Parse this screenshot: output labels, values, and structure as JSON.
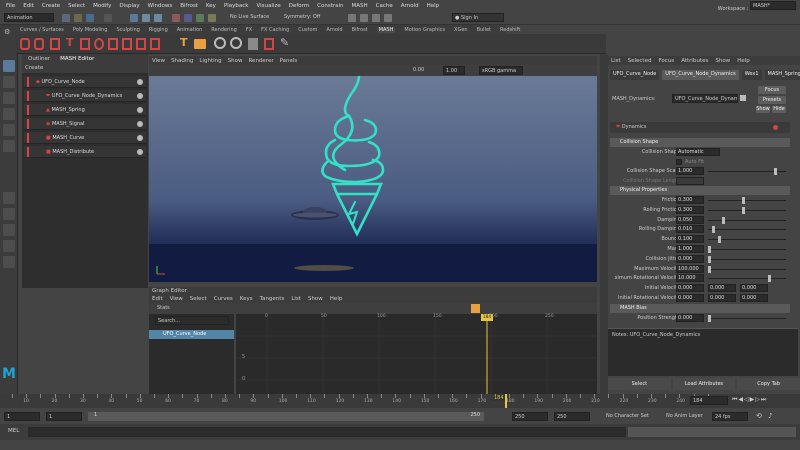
{
  "menu": [
    "File",
    "Edit",
    "Create",
    "Select",
    "Modify",
    "Display",
    "Windows",
    "Bifrost",
    "Key",
    "Playback",
    "Visualize",
    "Deform",
    "Constrain",
    "MASH",
    "Cache",
    "Arnold",
    "Help"
  ],
  "workspace": {
    "label": "Workspace :",
    "value": "MASH*"
  },
  "status": {
    "mode": "Animation",
    "live_surface": "No Live Surface",
    "symmetry": "Symmetry: Off",
    "sign_in": "Sign In"
  },
  "shelf_tabs": [
    "Curves / Surfaces",
    "Poly Modeling",
    "Sculpting",
    "Rigging",
    "Animation",
    "Rendering",
    "FX",
    "FX Caching",
    "Custom",
    "Arnold",
    "Bifrost",
    "MASH",
    "Motion Graphics",
    "XGen",
    "Bullet",
    "Redshift"
  ],
  "shelf_active": "MASH",
  "outliner": {
    "tabs": [
      "Outliner",
      "MASH Editor"
    ],
    "create": "Create",
    "nodes": [
      "UFO_Curve_Node",
      "UFO_Curve_Node_Dynamics",
      "MASH_Spring",
      "MASH_Signal",
      "MASH_Curve",
      "MASH_Distribute"
    ]
  },
  "viewport": {
    "menu": [
      "View",
      "Shading",
      "Lighting",
      "Show",
      "Renderer",
      "Panels"
    ],
    "num1": "0.00",
    "num2": "1.00",
    "colorspace": "sRGB gamma"
  },
  "graph_editor": {
    "title": "Graph Editor",
    "menu": [
      "Edit",
      "View",
      "Select",
      "Curves",
      "Keys",
      "Tangents",
      "List",
      "Show",
      "Help"
    ],
    "stats": "Stats",
    "search": "Search...",
    "node": "UFO_Curve_Node",
    "frame": "184",
    "ticks": [
      "0",
      "50",
      "100",
      "150",
      "200",
      "250"
    ],
    "yticks": [
      "5",
      "0"
    ]
  },
  "attr_editor": {
    "menu": [
      "List",
      "Selected",
      "Focus",
      "Attributes",
      "Show",
      "Help"
    ],
    "tabs": [
      "UFO_Curve_Node",
      "UFO_Curve_Node_Dynamics",
      "Wex1",
      "MASH_Spring"
    ],
    "node_label": "MASH_Dynamics:",
    "node_value": "UFO_Curve_Node_Dynamics",
    "focus": "Focus",
    "presets": "Presets",
    "show": "Show",
    "hide": "Hide",
    "section_title": "Dynamics",
    "collision_shape": {
      "title": "Collision Shape",
      "label": "Collision Shape",
      "value": "Automatic",
      "autofit": "Auto Fit",
      "scale_label": "Collision Shape Scale",
      "scale": "1.000",
      "length_label": "Collision Shape Length"
    },
    "physical": {
      "title": "Physical Properties",
      "rows": [
        {
          "label": "Friction",
          "value": "0.300"
        },
        {
          "label": "Rolling Friction",
          "value": "0.300"
        },
        {
          "label": "Damping",
          "value": "0.050"
        },
        {
          "label": "Rolling Damping",
          "value": "0.010"
        },
        {
          "label": "Bounce",
          "value": "0.100"
        },
        {
          "label": "Mass",
          "value": "1.000"
        },
        {
          "label": "Collision Jitter",
          "value": "0.000"
        },
        {
          "label": "Maximum Velocity",
          "value": "100.000"
        },
        {
          "label": "ximum Rotational Velocity",
          "value": "10.000"
        },
        {
          "label": "Initial Velocity",
          "value": "0.000",
          "v2": "0.000",
          "v3": "0.000"
        },
        {
          "label": "Initial Rotational Velocity",
          "value": "0.000",
          "v2": "0.000",
          "v3": "0.000"
        }
      ]
    },
    "bias": {
      "title": "MASH Bias",
      "label": "Position Strength",
      "value": "0.000"
    },
    "notes": "Notes: UFO_Curve_Node_Dynamics",
    "buttons": [
      "Select",
      "Load Attributes",
      "Copy Tab"
    ]
  },
  "timeline": {
    "ticks": [
      "5",
      "10",
      "15",
      "20",
      "25",
      "30",
      "35",
      "40",
      "45",
      "50",
      "55",
      "60",
      "65",
      "70",
      "75",
      "80",
      "85",
      "90",
      "95",
      "100",
      "105",
      "110",
      "115",
      "120",
      "125",
      "130",
      "135",
      "140",
      "145",
      "150",
      "155",
      "160",
      "165",
      "170",
      "175",
      "180",
      "185",
      "190",
      "195",
      "200",
      "205",
      "210",
      "215",
      "220",
      "225",
      "230",
      "235",
      "240",
      "245",
      "250"
    ],
    "current": "184",
    "current_field": "184"
  },
  "range": {
    "start": "1",
    "start2": "1",
    "anim_start": "1",
    "anim_end": "250",
    "end": "250",
    "end2": "250",
    "char_set": "No Character Set",
    "anim_layer": "No Anim Layer",
    "fps": "24 fps"
  },
  "mel": "MEL"
}
